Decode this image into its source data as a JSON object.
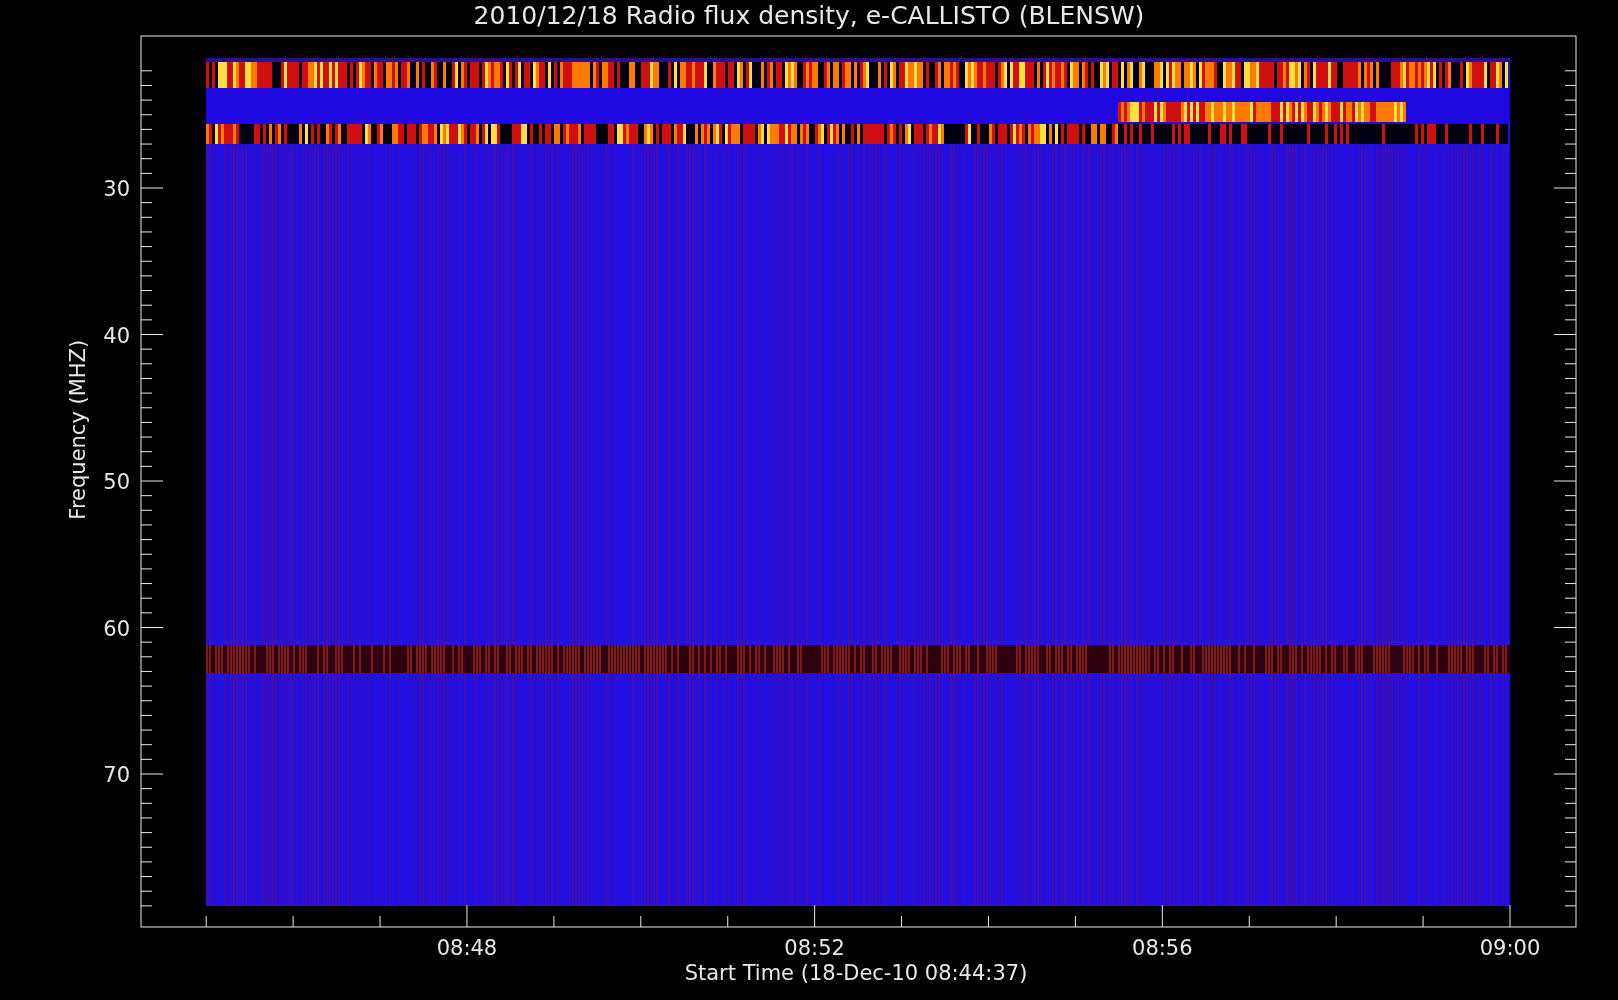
{
  "title": "2010/12/18  Radio flux density, e-CALLISTO (BLENSW)",
  "y_axis": {
    "title": "Frequency (MHZ)",
    "ticks": [
      "30",
      "40",
      "50",
      "60",
      "70"
    ]
  },
  "x_axis": {
    "title": "Start Time (18-Dec-10 08:44:37)",
    "ticks": [
      "08:48",
      "08:52",
      "08:56",
      "09:00"
    ]
  }
}
